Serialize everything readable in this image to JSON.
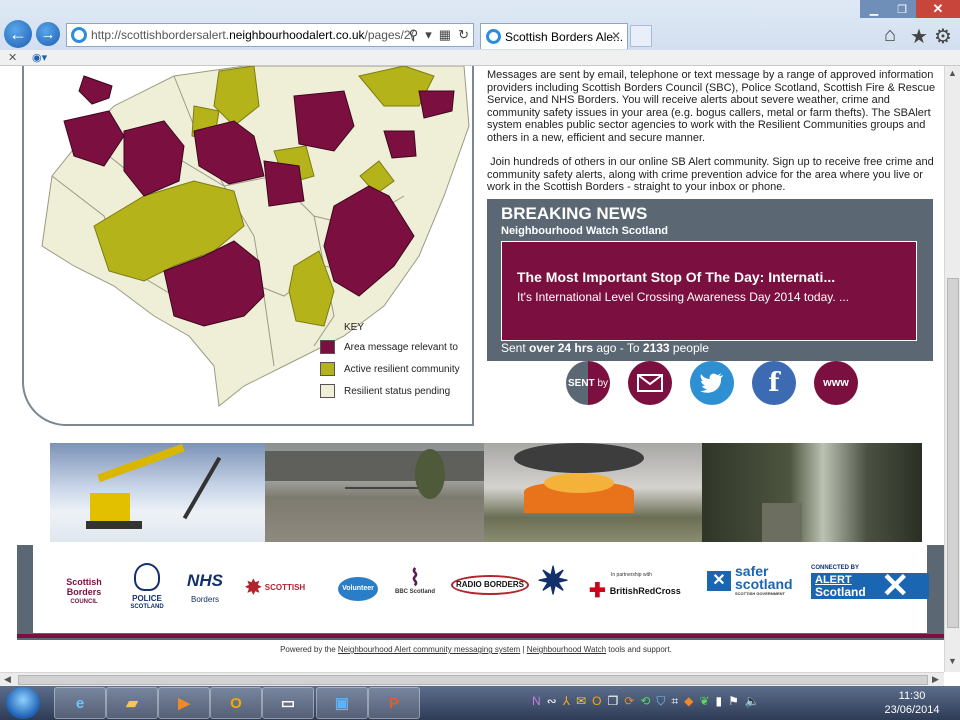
{
  "browser": {
    "address_prefix": "http://scottishbordersalert.",
    "address_domain": "neighbourhoodalert.co.uk",
    "address_path": "/pages/2(",
    "tab_title": "Scottish Borders Ale...",
    "tab_close": "✕"
  },
  "intro": {
    "paragraph_1": "Messages are sent by email, telephone or text message by a range of approved information providers including Scottish Borders Council (SBC), Police Scotland, Scottish Fire & Rescue Service, and NHS Borders.  You will receive alerts about severe weather, crime and community safety issues in your area (e.g. bogus callers, metal or farm thefts). The SBAlert system enables public sector agencies to work with the Resilient Communities groups and others in a new, efficient and secure manner.",
    "paragraph_2": " Join hundreds of others in our online SB Alert community. Sign up to receive free crime and community safety alerts, along with crime prevention advice for the area where you live or work in the Scottish Borders - straight to your inbox or phone."
  },
  "map_key": {
    "title": "KEY",
    "items": [
      {
        "label": "Area message relevant to",
        "color": "#7b0f3f"
      },
      {
        "label": "Active resilient community",
        "color": "#b5b31a"
      },
      {
        "label": "Resilient status pending",
        "color": "#efeed6"
      }
    ]
  },
  "news": {
    "title": "BREAKING NEWS",
    "subtitle": "Neighbourhood Watch Scotland",
    "headline": "The Most Important Stop Of The Day: Internati...",
    "body": "It's International Level Crossing Awareness Day 2014 today. ...",
    "sent_prefix": "Sent ",
    "sent_age": "over 24 hrs",
    "sent_mid": " ago - To ",
    "sent_count": "2133",
    "sent_suffix": " people"
  },
  "social": {
    "sent_label": "SENT",
    "sent_by": "by",
    "www_label": "www"
  },
  "partners": {
    "sbc_line1": "Scottish",
    "sbc_line2": "Borders",
    "sbc_line3": "COUNCIL",
    "police_line1": "POLICE",
    "police_line2": "SCOTLAND",
    "nhs": "NHS",
    "nhs_sub": "Borders",
    "fire": "SCOTTISH",
    "volunteer": "Volunteer",
    "bbc": "BBC Scotland",
    "radio": "RADIO BORDERS",
    "redcross_small": "In partnership with",
    "redcross": "BritishRedCross",
    "safer_1": "safer",
    "safer_2": "scotland",
    "safer_3": "SCOTTISH GOVERNMENT",
    "alert_small": "CONNECTED BY",
    "alert_1": "ALERT",
    "alert_2": "Scotland"
  },
  "footer": {
    "prefix": "Powered by the ",
    "link_1": "Neighbourhood Alert community messaging system",
    "sep": " | ",
    "link_2": "Neighbourhood Watch",
    "suffix": " tools and support."
  },
  "taskbar": {
    "time": "11:30",
    "date": "23/06/2014"
  },
  "colors": {
    "maroon": "#7b0f3f",
    "olive": "#b5b31a",
    "cream": "#efeed6",
    "slate": "#5b6874"
  }
}
